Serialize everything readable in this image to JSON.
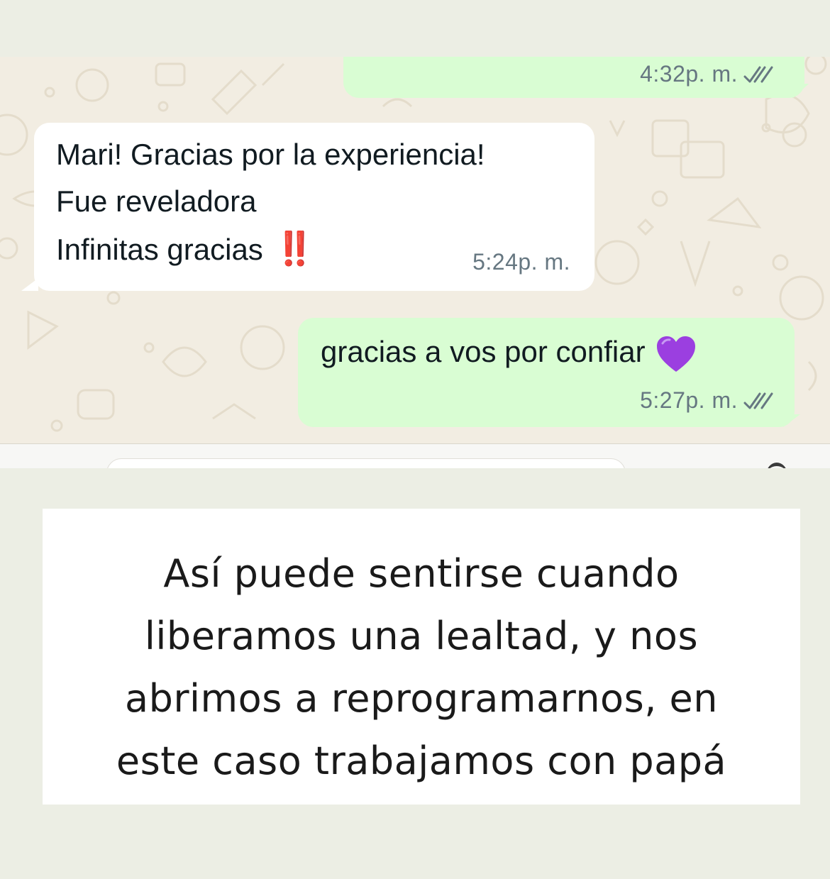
{
  "chat": {
    "messages": [
      {
        "direction": "outgoing",
        "lines": [],
        "time": "4:32",
        "suffix": "p. m.",
        "status": "read-double-check-icon"
      },
      {
        "direction": "incoming",
        "lines": [
          "Mari! Gracias por la experiencia!",
          "Fue reveladora",
          "Infinitas gracias"
        ],
        "emoji": "‼️",
        "time": "5:24",
        "suffix": "p. m."
      },
      {
        "direction": "outgoing",
        "lines": [
          "gracias a vos por confiar"
        ],
        "emoji": "💜",
        "time": "5:27",
        "suffix": "p. m.",
        "status": "read-double-check-icon"
      }
    ]
  },
  "caption": {
    "lines": [
      "Así puede sentirse cuando",
      "liberamos una lealtad, y nos",
      "abrimos a reprogramarnos, en",
      "este caso trabajamos con papá"
    ]
  },
  "colors": {
    "outgoing_bubble": "#d9fdd3",
    "incoming_bubble": "#ffffff",
    "chat_background": "#f2ede2",
    "excl_emoji": "#e11d1d",
    "heart_emoji": "#9b3fe0"
  }
}
